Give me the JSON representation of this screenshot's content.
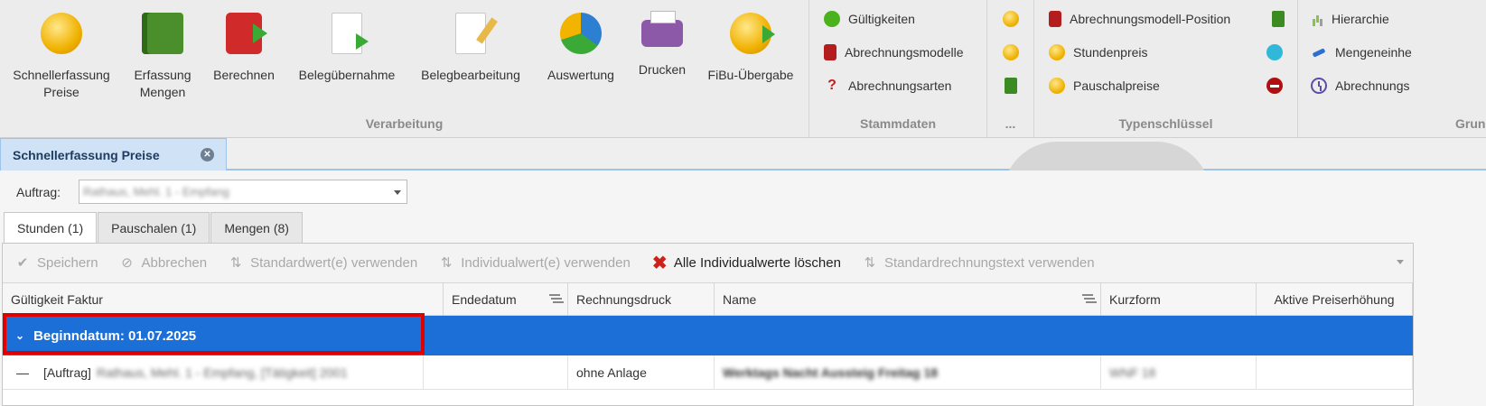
{
  "ribbon": {
    "big_buttons": [
      {
        "label": "Schnellerfassung\nPreise"
      },
      {
        "label": "Erfassung\nMengen"
      },
      {
        "label": "Berechnen"
      },
      {
        "label": "Belegübernahme"
      },
      {
        "label": "Belegbearbeitung"
      },
      {
        "label": "Auswertung"
      },
      {
        "label": "Drucken"
      },
      {
        "label": "FiBu-Übergabe"
      }
    ],
    "group_verarbeitung": "Verarbeitung",
    "stammdaten": {
      "items": [
        "Gültigkeiten",
        "Abrechnungsmodelle",
        "Abrechnungsarten"
      ],
      "label": "Stammdaten"
    },
    "dots_label": "...",
    "typenschluessel": {
      "items": [
        "Abrechnungsmodell-Position",
        "Stundenpreis",
        "Pauschalpreise"
      ],
      "label": "Typenschlüssel"
    },
    "grund": {
      "items": [
        "Hierarchie",
        "Mengeneinhe",
        "Abrechnungs"
      ],
      "label": "Grund"
    }
  },
  "doc_tab": {
    "label": "Schnellerfassung Preise"
  },
  "auftrag": {
    "label": "Auftrag:",
    "value": "Rathaus, Mehl. 1 - Empfang"
  },
  "tabs": [
    "Stunden (1)",
    "Pauschalen (1)",
    "Mengen (8)"
  ],
  "toolbar": {
    "save": "Speichern",
    "cancel": "Abbrechen",
    "std_value": "Standardwert(e) verwenden",
    "ind_value": "Individualwert(e) verwenden",
    "delete_all": "Alle Individualwerte löschen",
    "std_text": "Standardrechnungstext verwenden"
  },
  "columns": [
    "Gültigkeit Faktur",
    "Endedatum",
    "Rechnungsdruck",
    "Name",
    "Kurzform",
    "Aktive Preiserhöhung"
  ],
  "group_row": {
    "label": "Beginndatum: 01.07.2025"
  },
  "rows": [
    {
      "prefix": "[Auftrag]",
      "auftrag_blur": "Rathaus, Mehl. 1 - Empfang, [Tätigkeit] 2001",
      "rechnungsdruck": "ohne Anlage",
      "name_blur": "Werktags Nacht Aussteig Freitag 18",
      "kurzform_blur": "WNF 18"
    }
  ]
}
